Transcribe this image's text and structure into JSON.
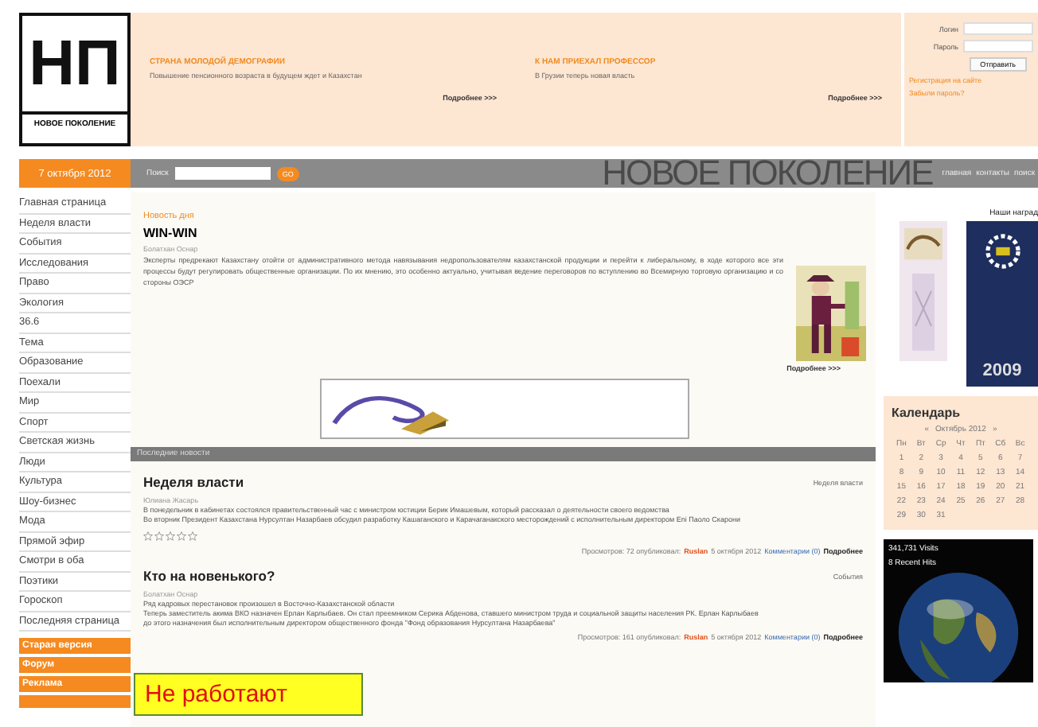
{
  "logo": {
    "letters": "НП",
    "caption": "НОВОЕ ПОКОЛЕНИЕ"
  },
  "headlines": [
    {
      "title": "СТРАНА МОЛОДОЙ ДЕМОГРАФИИ",
      "summary": "Повышение пенсионного возраста в будущем ждет и Казахстан",
      "more": "Подробнее >>>"
    },
    {
      "title": "К НАМ ПРИЕХАЛ ПРОФЕССОР",
      "summary": "В Грузии теперь новая власть",
      "more": "Подробнее >>>"
    }
  ],
  "login": {
    "login_label": "Логин",
    "password_label": "Пароль",
    "submit": "Отправить",
    "links": [
      "Регистрация на сайте",
      "Забыли пароль?"
    ]
  },
  "date": "7 октября 2012",
  "search": {
    "label": "Поиск",
    "button": "GO"
  },
  "banner_title": "НОВОЕ ПОКОЛЕНИЕ",
  "top_links": [
    "главная",
    "контакты",
    "поиск"
  ],
  "menu": [
    "Главная страница",
    "Неделя власти",
    "События",
    "Исследования",
    "Право",
    "Экология",
    "36.6",
    "Тема",
    "Образование",
    "Поехали",
    "Мир",
    "Спорт",
    "Светская жизнь",
    "Люди",
    "Культура",
    "Шоу-бизнес",
    "Мода",
    "Прямой эфир",
    "Смотри в оба",
    "Поэтики",
    "Гороскоп",
    "Последняя страница"
  ],
  "orange_links": [
    "Старая версия",
    "Форум",
    "Реклама"
  ],
  "news_of_day": {
    "heading": "Новость дня",
    "title": "WIN-WIN",
    "author": "Болатхан Оснар",
    "text": "Эксперты предрекают Казахстану отойти от административного метода навязывания недропользователям казахстанской продукции и перейти к либеральному, в ходе которого все эти процессы будут регулировать общественные организации. По их мнению, это особенно актуально, учитывая ведение переговоров по вступлению во Всемирную торговую организацию и со стороны ОЭСР",
    "more": "Подробнее >>>"
  },
  "latest_heading": "Последние новости",
  "news": [
    {
      "title": "Неделя власти",
      "category": "Неделя власти",
      "author": "Юлиана Жасарь",
      "lines": [
        "В понедельник в кабинетах состоялся правительственный час с министром юстиции Берик Имашевым, который рассказал о деятельности своего ведомства",
        "Во вторник Президент Казахстана Нурсултан Назарбаев обсудил разработку Кашаганского и Карачаганакского месторождений с исполнительным директором Eni Паоло Скарони"
      ],
      "stars": 0,
      "footer": [
        {
          "kind": "plain",
          "text": "Просмотров: 72 опубликовал:"
        },
        {
          "kind": "user",
          "text": "Ruslan"
        },
        {
          "kind": "plain",
          "text": "5 октября 2012"
        },
        {
          "kind": "link",
          "text": "Комментарии (0)"
        },
        {
          "kind": "bold",
          "text": "Подробнее"
        }
      ]
    },
    {
      "title": "Кто на новенького?",
      "category": "События",
      "author": "Болатхан Оснар",
      "lines": [
        "Ряд кадровых перестановок произошел в Восточно-Казахстанской области",
        "Теперь заместитель акима ВКО назначен Ерлан Карлыбаев. Он стал преемником Серика Абденова, ставшего министром труда и социальной защиты населения РК. Ерлан Карлыбаев",
        "до этого назначения был исполнительным директором общественного фонда \"Фонд образования Нурсултана Назарбаева\""
      ],
      "footer": [
        {
          "kind": "plain",
          "text": "Просмотров: 161 опубликовал:"
        },
        {
          "kind": "user",
          "text": "Ruslan"
        },
        {
          "kind": "plain",
          "text": "5 октября 2012"
        },
        {
          "kind": "link",
          "text": "Комментарии (0)"
        },
        {
          "kind": "bold",
          "text": "Подробнее"
        }
      ]
    }
  ],
  "notice": "Не работают",
  "awards": {
    "title": "Наши наград",
    "year": "2009"
  },
  "calendar": {
    "title": "Календарь",
    "prev": "«",
    "month": "Октябрь 2012",
    "next": "»",
    "weekdays": [
      "Пн",
      "Вт",
      "Ср",
      "Чт",
      "Пт",
      "Сб",
      "Вс"
    ],
    "weeks": [
      [
        "1",
        "2",
        "3",
        "4",
        "5",
        "6",
        "7"
      ],
      [
        "8",
        "9",
        "10",
        "11",
        "12",
        "13",
        "14"
      ],
      [
        "15",
        "16",
        "17",
        "18",
        "19",
        "20",
        "21"
      ],
      [
        "22",
        "23",
        "24",
        "25",
        "26",
        "27",
        "28"
      ],
      [
        "29",
        "30",
        "31"
      ]
    ]
  },
  "globe": {
    "visits": "341,731 Visits",
    "hits": "8 Recent Hits"
  }
}
